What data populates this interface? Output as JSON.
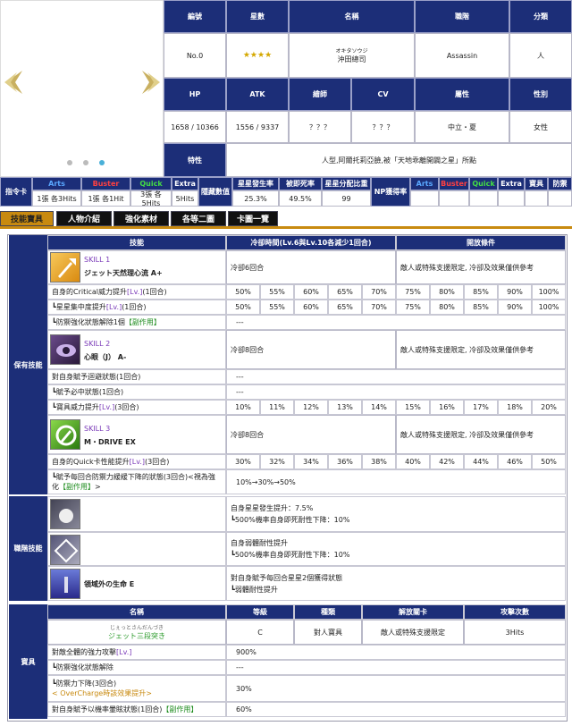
{
  "profile": {
    "headers1": [
      "編號",
      "星數",
      "名稱",
      "職階",
      "分類"
    ],
    "number": "No.0",
    "stars": "★★★★",
    "name_ruby": "オキタソウジ",
    "name": "沖田總司",
    "class": "Assassin",
    "category": "人",
    "headers2": [
      "HP",
      "ATK",
      "繪師",
      "CV",
      "屬性",
      "性別"
    ],
    "hp": "1658 / 10366",
    "atk": "1556 / 9337",
    "illustrator": "？？？",
    "cv": "？？？",
    "attribute": "中立・夏",
    "gender": "女性",
    "trait_label": "特性",
    "trait": "人型,阿爾托莉亞臉,被「天地乖離開闢之星」所點"
  },
  "cards": {
    "label": "指令卡",
    "headers": [
      "Arts",
      "Buster",
      "Quick",
      "Extra"
    ],
    "values": [
      "1張 各3Hits",
      "1張 各1Hit",
      "3張 各5Hits",
      "5Hits"
    ],
    "hidden_label": "隱藏數值",
    "stat_headers": [
      "星星發生率",
      "被即死率",
      "星星分配比重"
    ],
    "stat_values": [
      "25.3%",
      "49.5%",
      "99"
    ],
    "np_label": "NP獲得率",
    "np_headers": [
      "Arts",
      "Buster",
      "Quick",
      "Extra",
      "寶具",
      "防禦"
    ]
  },
  "tabs": [
    "技能寶具",
    "人物介紹",
    "強化素材",
    "各等二圖",
    "卡圖一覽"
  ],
  "skills": {
    "section_label": "保有技能",
    "headers": [
      "技能",
      "冷卻時間(Lv.6與Lv.10各減少1回合)",
      "開放條件"
    ],
    "s1": {
      "num": "SKILL 1",
      "name": "ジェット天然理心流 A+",
      "cd": "冷卻6回合",
      "cond": "敵人或特殊支援限定, 冷卻及效果僅供參考"
    },
    "s1_rows": [
      {
        "label": "自身的Critical威力提升",
        "lv": "[Lv.]",
        "tail": "(1回合)",
        "vals": [
          "50%",
          "55%",
          "60%",
          "65%",
          "70%",
          "75%",
          "80%",
          "85%",
          "90%",
          "100%"
        ]
      },
      {
        "pre": "┗",
        "label": "星星集中度提升",
        "lv": "[Lv.]",
        "tail": "(1回合)",
        "vals": [
          "50%",
          "55%",
          "60%",
          "65%",
          "70%",
          "75%",
          "80%",
          "85%",
          "90%",
          "100%"
        ]
      },
      {
        "pre": "┗",
        "label": "防禦強化狀態解除1個",
        "lv": "",
        "tail": "",
        "tag": "【副作用】",
        "single": "---"
      }
    ],
    "s2": {
      "num": "SKILL 2",
      "name": "心眼（J） A-",
      "cd": "冷卻8回合",
      "cond": "敵人或特殊支援限定, 冷卻及效果僅供參考"
    },
    "s2_rows": [
      {
        "label": "對自身賦予迴避狀態(1回合)",
        "single": "---"
      },
      {
        "pre": "┗",
        "label": "賦予必中狀態(1回合)",
        "single": "---"
      },
      {
        "pre": "┗",
        "label": "寶具威力提升",
        "lv": "[Lv.]",
        "tail": "(3回合)",
        "vals": [
          "10%",
          "11%",
          "12%",
          "13%",
          "14%",
          "15%",
          "16%",
          "17%",
          "18%",
          "20%"
        ]
      }
    ],
    "s3": {
      "num": "SKILL 3",
      "name": "M・DRIVE EX",
      "cd": "冷卻8回合",
      "cond": "敵人或特殊支援限定, 冷卻及效果僅供參考"
    },
    "s3_rows": [
      {
        "label": "自身的Quick卡性能提升",
        "lv": "[Lv.]",
        "tail": "(3回合)",
        "vals": [
          "30%",
          "32%",
          "34%",
          "36%",
          "38%",
          "40%",
          "42%",
          "44%",
          "46%",
          "50%"
        ]
      }
    ],
    "s3_extra": {
      "label": "┗賦予每回合防禦力緩緩下降的狀態(3回合)<視為強化",
      "tag": "【副作用】",
      "label2": ">",
      "value": "10%→30%→50%"
    }
  },
  "class_skills": {
    "section_label": "職階技能",
    "items": [
      {
        "name": "",
        "lines": [
          "自身星星發生提升：7.5%",
          "┗500%機率自身即死耐性下降：10%"
        ]
      },
      {
        "name": "",
        "lines": [
          "自身弱體耐性提升",
          "┗500%機率自身即死耐性下降：10%"
        ]
      },
      {
        "name": "領域外の生命 E",
        "lines": [
          "對自身賦予每回合星星2個獲得狀態",
          "┗弱體耐性提升"
        ]
      }
    ]
  },
  "np": {
    "section_label": "寶具",
    "headers": [
      "名稱",
      "等級",
      "種類",
      "解放關卡",
      "攻擊次數"
    ],
    "ruby": "じぇっとさんだんづき",
    "name": "ジェット三段突き",
    "rank": "C",
    "type": "對人寶具",
    "unlock": "敵人或特殊支援限定",
    "hits": "3Hits",
    "rows": [
      {
        "label": "對敵全體的強力攻擊",
        "lv": "[Lv.]",
        "value": "900%"
      },
      {
        "label": "┗防禦強化狀態解除",
        "value": "---"
      },
      {
        "label": "┗防禦力下降(3回合)",
        "sub": "< OverCharge時該效果提升>",
        "value": "30%"
      },
      {
        "label": "對自身賦予以機率暈眩狀態(1回合)",
        "tag": "【副作用】",
        "value": "60%"
      }
    ]
  }
}
